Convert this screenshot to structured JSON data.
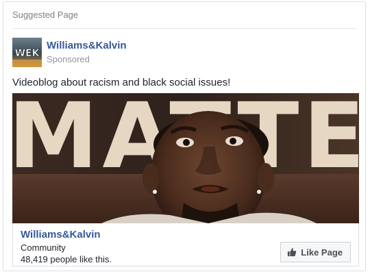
{
  "card": {
    "header": "Suggested Page"
  },
  "page": {
    "name": "Williams&Kalvin",
    "sponsored_label": "Sponsored",
    "avatar_text": "WEK",
    "avatar_icon": "page-logo"
  },
  "post": {
    "text": "Videoblog about racism and black social issues!"
  },
  "video": {
    "background_text": "MATTER",
    "icon": "video-thumbnail"
  },
  "link": {
    "title": "Williams&Kalvin",
    "category": "Community",
    "likes": "48,419 people like this.",
    "like_button_label": "Like Page",
    "like_button_icon": "thumbs-up-icon"
  },
  "colors": {
    "link_blue": "#365899",
    "meta_gray": "#90949c",
    "border": "#dddfe2",
    "button_bg": "#f6f7f9",
    "button_text": "#4b4f56"
  }
}
